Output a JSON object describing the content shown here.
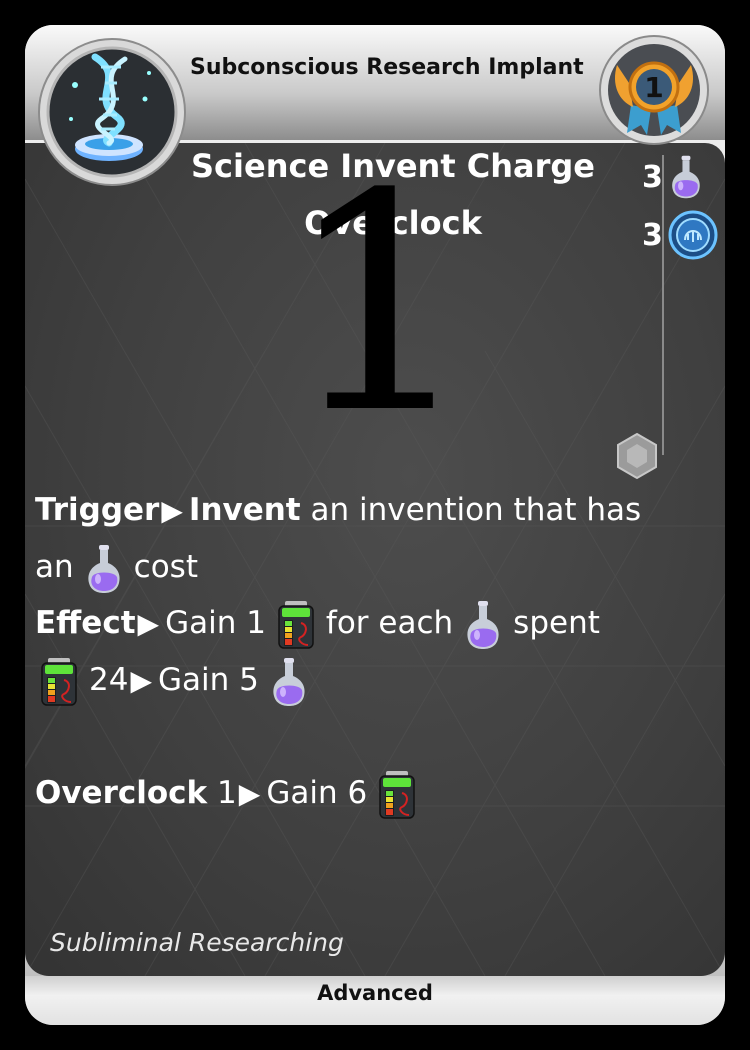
{
  "card": {
    "name": "Subconscious Research Implant",
    "type_label": "Advanced",
    "title_line1": "Science Invent Charge",
    "title_line2": "Overclock",
    "big_number": "1",
    "medal_number": "1",
    "costs": [
      {
        "value": "3",
        "icon": "science-flask-icon"
      },
      {
        "value": "3",
        "icon": "research-disc-icon"
      }
    ],
    "rules": {
      "trigger_label": "Trigger",
      "invent_label": "Invent",
      "trigger_text_a": "an invention that has",
      "trigger_text_b": "an",
      "trigger_text_c": "cost",
      "effect_label": "Effect",
      "effect_text_a": "Gain 1",
      "effect_text_b": "for each",
      "effect_text_c": "spent",
      "charge_threshold": "24",
      "effect_text_d": "Gain 5",
      "overclock_label": "Overclock",
      "overclock_value": "1",
      "overclock_text": "Gain 6"
    },
    "flavor": "Subliminal Researching",
    "colors": {
      "flask": "#9a6bf0",
      "battery": "#5ee33a",
      "disc": "#3aa0e8"
    }
  }
}
